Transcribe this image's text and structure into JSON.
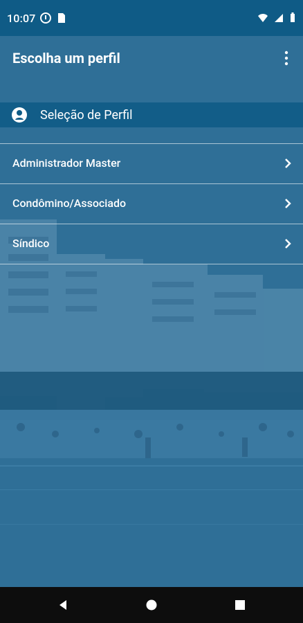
{
  "status": {
    "time": "10:07",
    "left_icons": [
      "notification-icon",
      "sim-card-icon"
    ],
    "right_icons": [
      "wifi-icon",
      "signal-icon",
      "battery-icon"
    ]
  },
  "appbar": {
    "title": "Escolha um perfil",
    "overflow_icon": "more-vert-icon"
  },
  "section": {
    "icon": "profile-icon",
    "label": "Seleção de Perfil"
  },
  "profiles": [
    {
      "label": "Administrador Master"
    },
    {
      "label": "Condômino/Associado"
    },
    {
      "label": "Síndico"
    }
  ],
  "navigation": {
    "buttons": [
      "back-icon",
      "home-icon",
      "recents-icon"
    ]
  },
  "colors": {
    "primary": "#0f5b86",
    "background_overlay": "#2f6f97",
    "divider": "#ffffff"
  }
}
